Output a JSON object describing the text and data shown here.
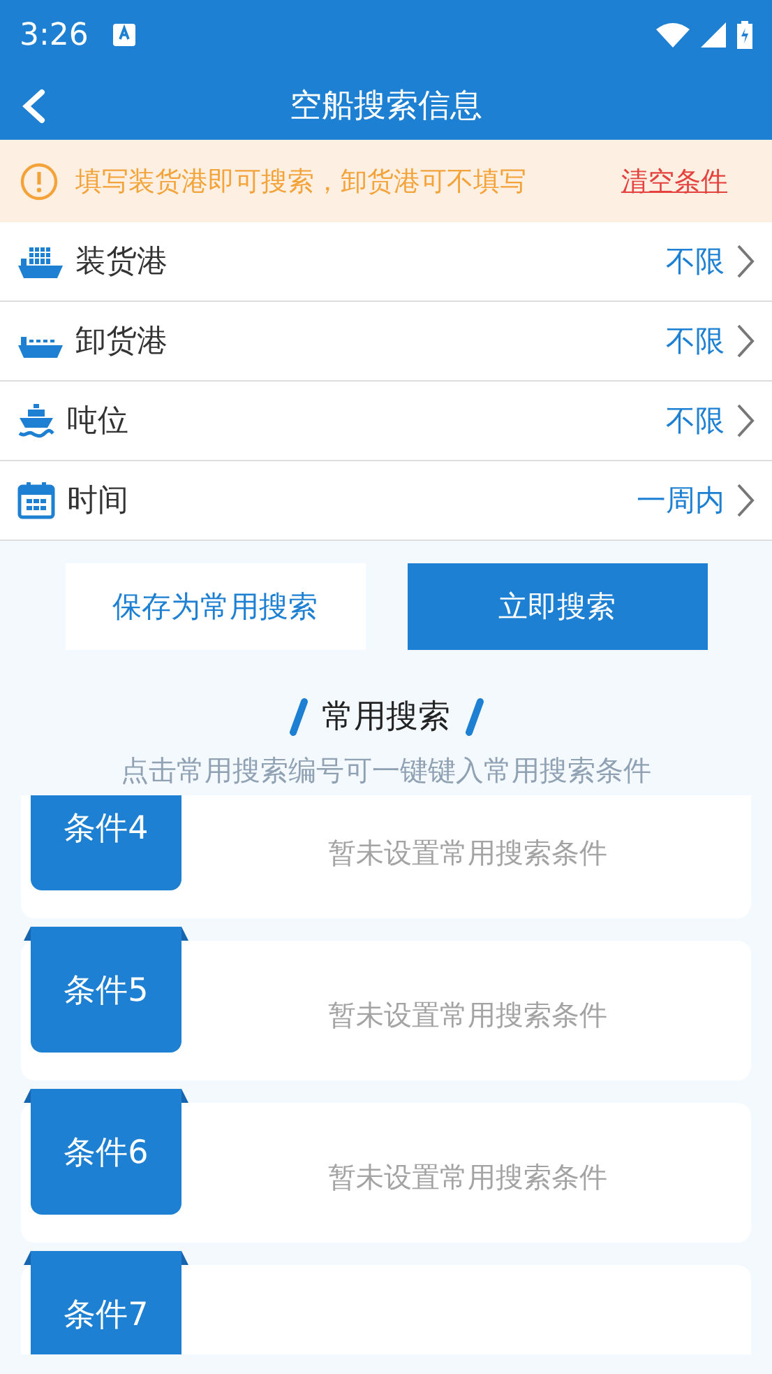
{
  "status_bar": {
    "time": "3:26"
  },
  "header": {
    "title": "空船搜索信息"
  },
  "notice": {
    "text": "填写装货港即可搜索，卸货港可不填写",
    "action": "清空条件"
  },
  "filters": [
    {
      "kind": "loading",
      "label": "装货港",
      "value": "不限"
    },
    {
      "kind": "unloading",
      "label": "卸货港",
      "value": "不限"
    },
    {
      "kind": "tonnage",
      "label": "吨位",
      "value": "不限"
    },
    {
      "kind": "time",
      "label": "时间",
      "value": "一周内"
    }
  ],
  "buttons": {
    "save": "保存为常用搜索",
    "search": "立即搜索"
  },
  "saved": {
    "title": "常用搜索",
    "subtitle": "点击常用搜索编号可一键键入常用搜索条件",
    "items": [
      {
        "label": "条件4",
        "text": "暂未设置常用搜索条件"
      },
      {
        "label": "条件5",
        "text": "暂未设置常用搜索条件"
      },
      {
        "label": "条件6",
        "text": "暂未设置常用搜索条件"
      },
      {
        "label": "条件7"
      }
    ]
  }
}
